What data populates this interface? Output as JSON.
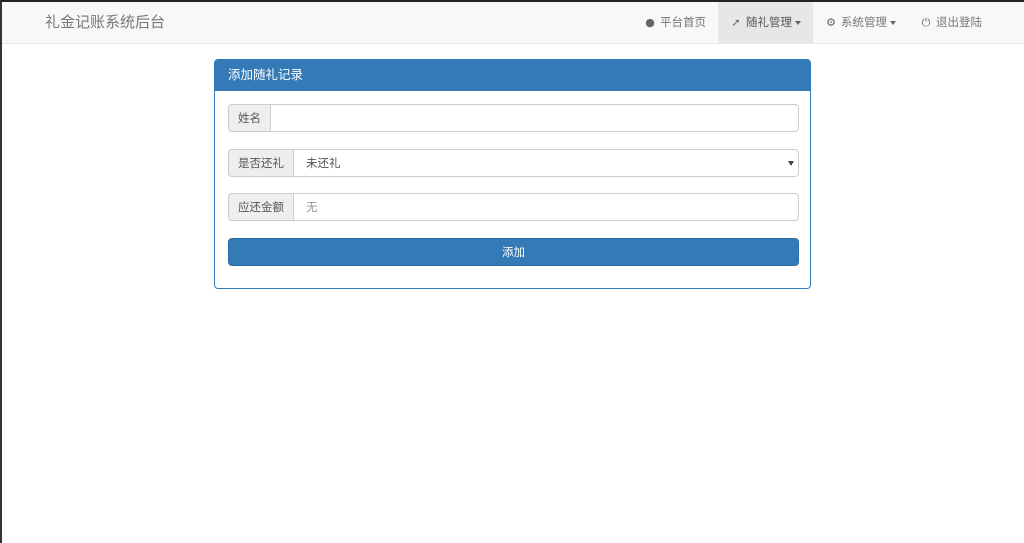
{
  "navbar": {
    "brand": "礼金记账系统后台",
    "items": [
      {
        "label": "平台首页",
        "icon": "user-icon",
        "glyph": "👤",
        "active": false,
        "dropdown": false
      },
      {
        "label": "随礼管理",
        "icon": "pushpin-icon",
        "glyph": "📌",
        "active": true,
        "dropdown": true
      },
      {
        "label": "系统管理",
        "icon": "gear-icon",
        "glyph": "⚙",
        "active": false,
        "dropdown": true
      },
      {
        "label": "退出登陆",
        "icon": "power-icon",
        "glyph": "⏻",
        "active": false,
        "dropdown": false
      }
    ]
  },
  "panel": {
    "title": "添加随礼记录",
    "fields": {
      "name": {
        "label": "姓名",
        "value": "",
        "placeholder": ""
      },
      "returned": {
        "label": "是否还礼",
        "value": "未还礼"
      },
      "amount": {
        "label": "应还金额",
        "value": "",
        "placeholder": "无"
      }
    },
    "submit_label": "添加"
  },
  "colors": {
    "primary": "#337ab7",
    "navbar_bg": "#f8f8f8",
    "active_nav_bg": "#e7e7e7"
  }
}
